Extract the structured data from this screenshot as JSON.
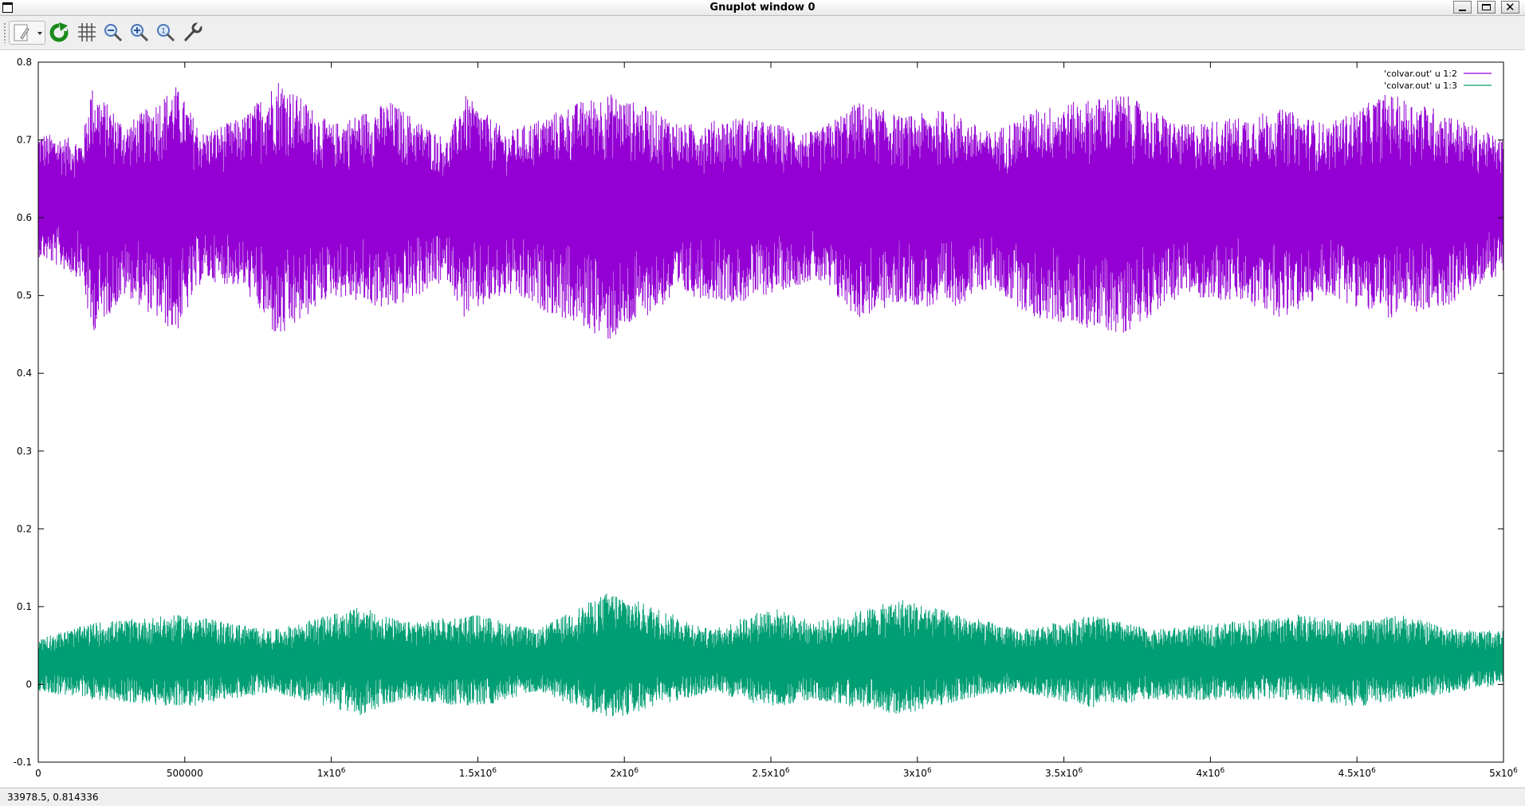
{
  "window": {
    "title": "Gnuplot window 0"
  },
  "toolbar": {
    "items": [
      "export-menu",
      "replot",
      "toggle-grid",
      "zoom-previous",
      "zoom-next",
      "autoscale",
      "options"
    ]
  },
  "status": {
    "text": "33978.5,  0.814336"
  },
  "chart_data": {
    "type": "line",
    "title": "",
    "xlabel": "",
    "ylabel": "",
    "xlim": [
      0,
      5000000
    ],
    "ylim": [
      -0.1,
      0.8
    ],
    "grid": false,
    "legend_position": "top-right",
    "x_ticks": [
      {
        "value": 0,
        "base": "0",
        "exp": ""
      },
      {
        "value": 500000,
        "base": "500000",
        "exp": ""
      },
      {
        "value": 1000000,
        "base": "1x10",
        "exp": "6"
      },
      {
        "value": 1500000,
        "base": "1.5x10",
        "exp": "6"
      },
      {
        "value": 2000000,
        "base": "2x10",
        "exp": "6"
      },
      {
        "value": 2500000,
        "base": "2.5x10",
        "exp": "6"
      },
      {
        "value": 3000000,
        "base": "3x10",
        "exp": "6"
      },
      {
        "value": 3500000,
        "base": "3.5x10",
        "exp": "6"
      },
      {
        "value": 4000000,
        "base": "4x10",
        "exp": "6"
      },
      {
        "value": 4500000,
        "base": "4.5x10",
        "exp": "6"
      },
      {
        "value": 5000000,
        "base": "5x10",
        "exp": "6"
      }
    ],
    "y_ticks": [
      "-0.1",
      "0",
      "0.1",
      "0.2",
      "0.3",
      "0.4",
      "0.5",
      "0.6",
      "0.7",
      "0.8"
    ],
    "series": [
      {
        "name": "'colvar.out' u 1:2",
        "color": "#9400d3",
        "center": 0.62,
        "x": [
          0,
          150000,
          180000,
          300000,
          470000,
          560000,
          700000,
          820000,
          1000000,
          1200000,
          1400000,
          1450000,
          1600000,
          1850000,
          1950000,
          2100000,
          2200000,
          2400000,
          2650000,
          2800000,
          2950000,
          3100000,
          3250000,
          3400000,
          3550000,
          3700000,
          3900000,
          4100000,
          4250000,
          4400000,
          4600000,
          4780000,
          5000000
        ],
        "y_max": [
          0.71,
          0.7,
          0.77,
          0.72,
          0.77,
          0.71,
          0.73,
          0.78,
          0.72,
          0.75,
          0.7,
          0.76,
          0.71,
          0.75,
          0.76,
          0.74,
          0.72,
          0.73,
          0.71,
          0.75,
          0.73,
          0.74,
          0.71,
          0.74,
          0.75,
          0.76,
          0.72,
          0.73,
          0.74,
          0.72,
          0.76,
          0.74,
          0.7
        ],
        "y_min": [
          0.55,
          0.52,
          0.45,
          0.5,
          0.45,
          0.52,
          0.51,
          0.44,
          0.5,
          0.48,
          0.52,
          0.47,
          0.5,
          0.46,
          0.44,
          0.48,
          0.5,
          0.49,
          0.52,
          0.47,
          0.49,
          0.48,
          0.51,
          0.47,
          0.46,
          0.45,
          0.5,
          0.49,
          0.47,
          0.5,
          0.47,
          0.48,
          0.53
        ]
      },
      {
        "name": "'colvar.out' u 1:3",
        "color": "#009e73",
        "center": 0.03,
        "x": [
          0,
          200000,
          500000,
          650000,
          800000,
          1100000,
          1250000,
          1500000,
          1700000,
          1850000,
          1950000,
          2100000,
          2300000,
          2500000,
          2650000,
          2950000,
          3150000,
          3350000,
          3600000,
          3800000,
          4050000,
          4300000,
          4500000,
          4650000,
          4850000,
          5000000
        ],
        "y_max": [
          0.06,
          0.08,
          0.09,
          0.08,
          0.07,
          0.1,
          0.08,
          0.09,
          0.07,
          0.1,
          0.12,
          0.1,
          0.07,
          0.1,
          0.08,
          0.11,
          0.09,
          0.07,
          0.09,
          0.07,
          0.08,
          0.09,
          0.08,
          0.09,
          0.07,
          0.07
        ],
        "y_min": [
          -0.01,
          -0.02,
          -0.03,
          -0.02,
          -0.01,
          -0.04,
          -0.02,
          -0.03,
          -0.01,
          -0.03,
          -0.045,
          -0.03,
          -0.01,
          -0.03,
          -0.02,
          -0.04,
          -0.02,
          -0.01,
          -0.03,
          -0.02,
          -0.02,
          -0.02,
          -0.03,
          -0.02,
          -0.01,
          0.0
        ]
      }
    ]
  }
}
